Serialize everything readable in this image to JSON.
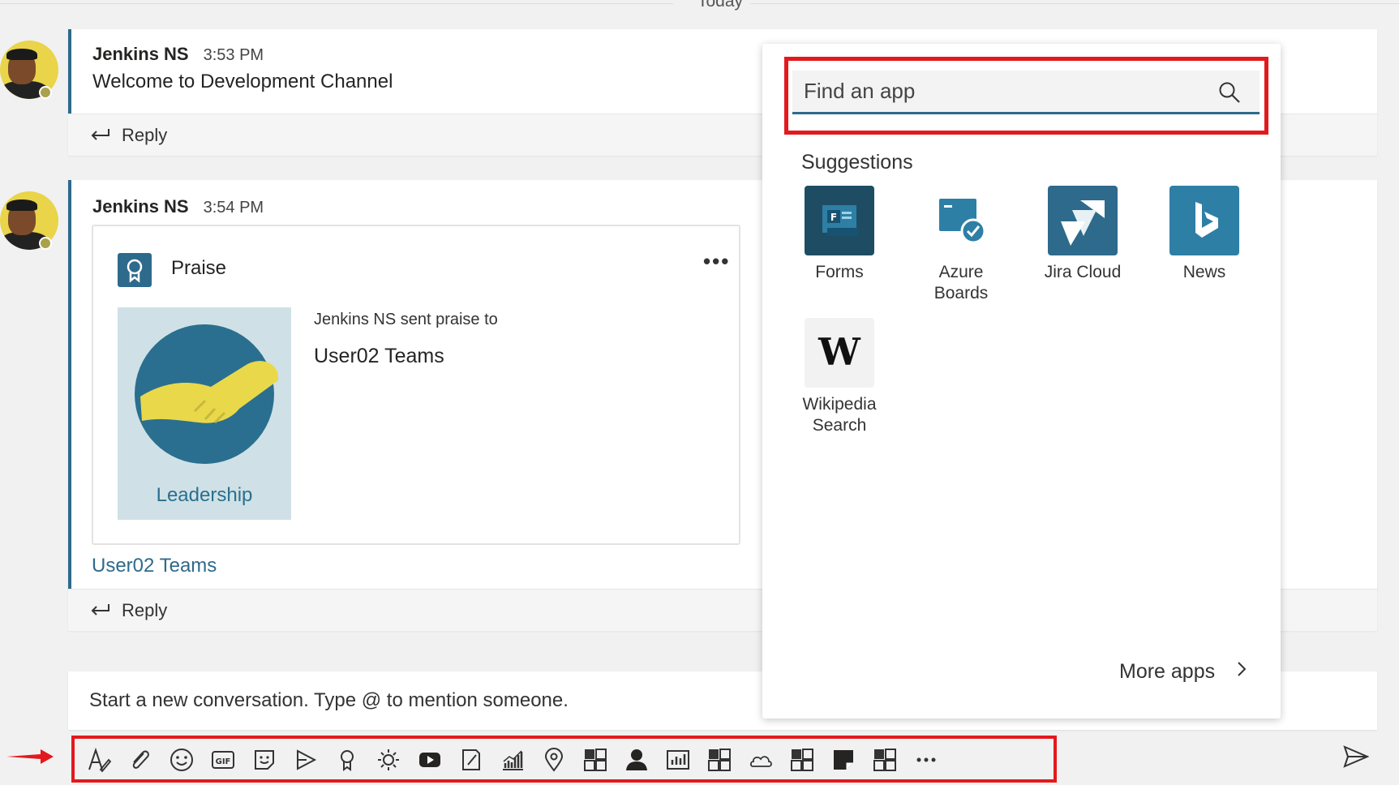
{
  "date_divider": {
    "label": "Today"
  },
  "messages": [
    {
      "author": "Jenkins NS",
      "time": "3:53 PM",
      "text": "Welcome to Development Channel",
      "reply_label": "Reply"
    },
    {
      "author": "Jenkins NS",
      "time": "3:54 PM",
      "reply_label": "Reply",
      "praise": {
        "title": "Praise",
        "more": "•••",
        "badge_label": "Leadership",
        "sent_text": "Jenkins NS sent praise to",
        "recipient": "User02 Teams"
      },
      "mention": "User02 Teams"
    }
  ],
  "compose": {
    "placeholder": "Start a new conversation. Type @ to mention someone."
  },
  "toolbar": {
    "icons": [
      "format-icon",
      "attach-icon",
      "emoji-icon",
      "gif-icon",
      "sticker-icon",
      "meet-icon",
      "praise-icon",
      "weather-icon",
      "youtube-icon",
      "notes-icon",
      "chart-icon",
      "location-icon",
      "app-icon",
      "person-icon",
      "report-icon",
      "app-icon",
      "cloud-icon",
      "app-icon",
      "note-icon",
      "app-icon",
      "more-icon"
    ]
  },
  "app_flyout": {
    "search_placeholder": "Find an app",
    "suggestions_title": "Suggestions",
    "apps": [
      {
        "name": "Forms",
        "color": "#1e4d63"
      },
      {
        "name": "Azure Boards",
        "color": "#2e7fa6"
      },
      {
        "name": "Jira Cloud",
        "color": "#2e6a8c"
      },
      {
        "name": "News",
        "color": "#2e7fa6"
      },
      {
        "name": "Wikipedia Search",
        "color": "#f2f2f2"
      }
    ],
    "more_apps": "More apps"
  },
  "colors": {
    "accent": "#2e6a8c",
    "highlight_red": "#e3191e"
  }
}
